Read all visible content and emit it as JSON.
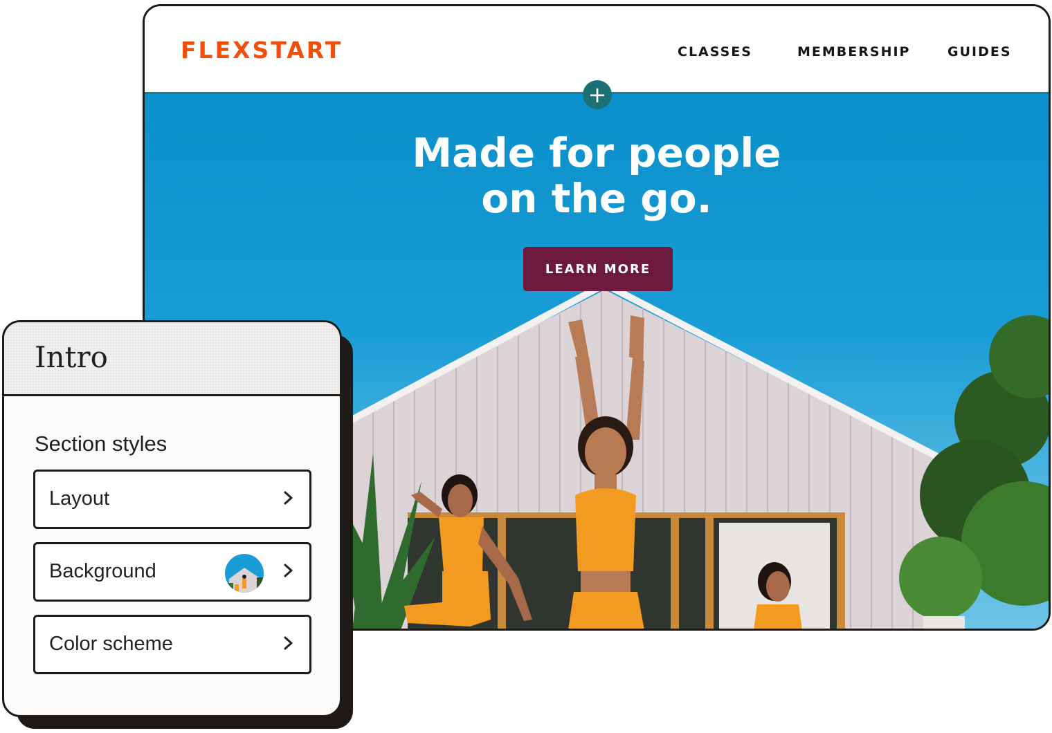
{
  "site": {
    "logo": "FLEXSTART",
    "nav": [
      "CLASSES",
      "MEMBERSHIP",
      "GUIDES"
    ],
    "hero": {
      "title_line1": "Made for people",
      "title_line2": "on the go.",
      "cta_label": "LEARN MORE"
    },
    "add_section_symbol": "+"
  },
  "panel": {
    "title": "Intro",
    "section_heading": "Section styles",
    "rows": [
      {
        "label": "Layout"
      },
      {
        "label": "Background"
      },
      {
        "label": "Color scheme"
      }
    ]
  },
  "icons": {
    "add": "plus-icon",
    "row_arrow": "chevron-right-icon",
    "background_thumbnail": "hero-image-thumbnail"
  },
  "colors": {
    "brand_orange": "#f24f0f",
    "cta_maroon": "#6e1a3c",
    "accent_teal": "#1b7176",
    "sky_blue": "#1a9dd6",
    "outfit_orange": "#f39a20",
    "outline_dark": "#1d1a18"
  }
}
